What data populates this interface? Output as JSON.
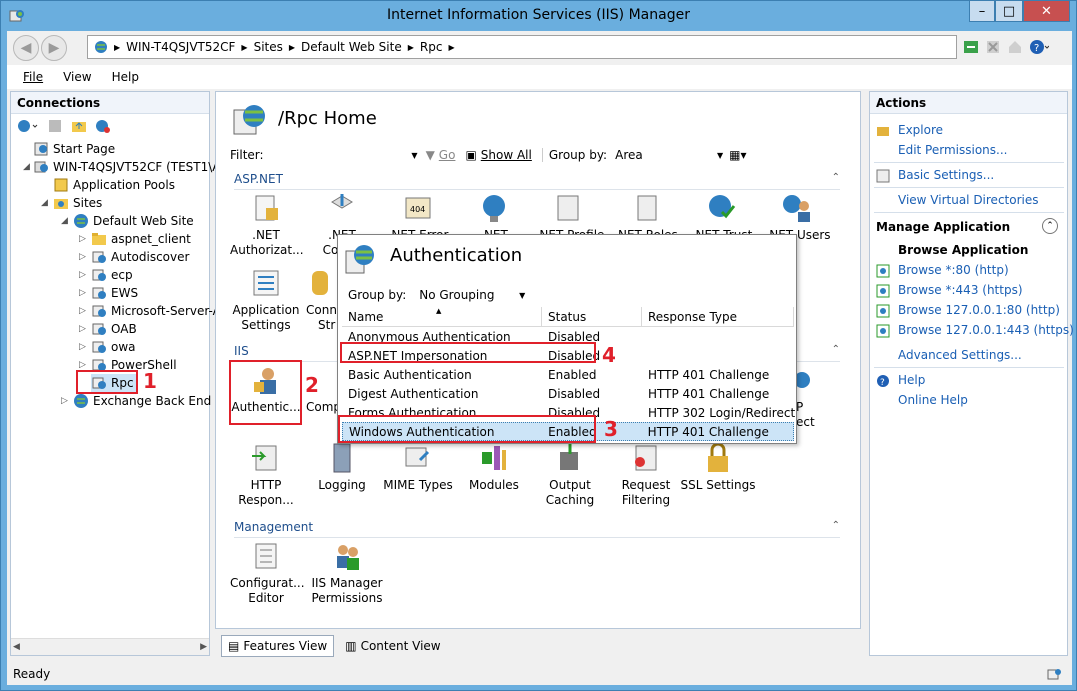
{
  "window": {
    "title": "Internet Information Services (IIS) Manager",
    "minimize": "–",
    "maximize": "□",
    "close": "✕"
  },
  "address": {
    "segments": [
      "WIN-T4QSJVT52CF",
      "Sites",
      "Default Web Site",
      "Rpc"
    ]
  },
  "menu": {
    "file": "File",
    "view": "View",
    "help": "Help"
  },
  "connections": {
    "title": "Connections",
    "tree": [
      {
        "label": "Start Page"
      },
      {
        "label": "WIN-T4QSJVT52CF (TEST1\\Ad"
      },
      {
        "label": "Application Pools"
      },
      {
        "label": "Sites"
      },
      {
        "label": "Default Web Site"
      },
      {
        "label": "aspnet_client"
      },
      {
        "label": "Autodiscover"
      },
      {
        "label": "ecp"
      },
      {
        "label": "EWS"
      },
      {
        "label": "Microsoft-Server-A"
      },
      {
        "label": "OAB"
      },
      {
        "label": "owa"
      },
      {
        "label": "PowerShell"
      },
      {
        "label": "Rpc"
      },
      {
        "label": "Exchange Back End"
      }
    ]
  },
  "center": {
    "title": "/Rpc Home",
    "filter_label": "Filter:",
    "go_label": "Go",
    "show_all_label": "Show All",
    "group_by_label": "Group by:",
    "group_by_value": "Area",
    "groups": {
      "aspnet": "ASP.NET",
      "iis": "IIS",
      "management": "Management"
    },
    "aspnet_features": [
      {
        "l1": ".NET",
        "l2": "Authorizat..."
      },
      {
        "l1": ".NET",
        "l2": "Com..."
      },
      {
        "l1": ".NET Error",
        "l2": ""
      },
      {
        "l1": ".NET",
        "l2": ""
      },
      {
        "l1": ".NET Profile",
        "l2": ""
      },
      {
        "l1": ".NET Roles",
        "l2": ""
      },
      {
        "l1": ".NET Trust",
        "l2": ""
      },
      {
        "l1": ".NET Users",
        "l2": ""
      },
      {
        "l1": "Application",
        "l2": "Settings"
      },
      {
        "l1": "Conn",
        "l2": "Str"
      }
    ],
    "iis_features": [
      {
        "l1": "Authentic...",
        "l2": ""
      },
      {
        "l1": "Comp",
        "l2": ""
      },
      {
        "l1": "HTTP",
        "l2": "Respon..."
      },
      {
        "l1": "Logging",
        "l2": ""
      },
      {
        "l1": "MIME Types",
        "l2": ""
      },
      {
        "l1": "Modules",
        "l2": ""
      },
      {
        "l1": "Output",
        "l2": "Caching"
      },
      {
        "l1": "Request",
        "l2": "Filtering"
      },
      {
        "l1": "SSL Settings",
        "l2": ""
      },
      {
        "l1": "P",
        "l2": "ect"
      }
    ],
    "management_features": [
      {
        "l1": "Configurat...",
        "l2": "Editor"
      },
      {
        "l1": "IIS Manager",
        "l2": "Permissions"
      }
    ],
    "features_view": "Features View",
    "content_view": "Content View"
  },
  "auth_popup": {
    "title": "Authentication",
    "group_by_label": "Group by:",
    "group_by_value": "No Grouping",
    "columns": [
      "Name",
      "Status",
      "Response Type"
    ],
    "rows": [
      {
        "name": "Anonymous Authentication",
        "status": "Disabled",
        "response": ""
      },
      {
        "name": "ASP.NET Impersonation",
        "status": "Disabled",
        "response": ""
      },
      {
        "name": "Basic Authentication",
        "status": "Enabled",
        "response": "HTTP 401 Challenge"
      },
      {
        "name": "Digest Authentication",
        "status": "Disabled",
        "response": "HTTP 401 Challenge"
      },
      {
        "name": "Forms Authentication",
        "status": "Disabled",
        "response": "HTTP 302 Login/Redirect"
      },
      {
        "name": "Windows Authentication",
        "status": "Enabled",
        "response": "HTTP 401 Challenge"
      }
    ]
  },
  "actions": {
    "title": "Actions",
    "explore": "Explore",
    "edit_permissions": "Edit Permissions...",
    "basic_settings": "Basic Settings...",
    "view_virtual_dirs": "View Virtual Directories",
    "manage_app": "Manage Application",
    "browse_app": "Browse Application",
    "browse": [
      "Browse *:80 (http)",
      "Browse *:443 (https)",
      "Browse 127.0.0.1:80 (http)",
      "Browse 127.0.0.1:443 (https)"
    ],
    "advanced_settings": "Advanced Settings...",
    "help": "Help",
    "online_help": "Online Help"
  },
  "annotations": {
    "n1": "1",
    "n2": "2",
    "n3": "3",
    "n4": "4",
    "color": "#e0202a"
  },
  "status": {
    "text": "Ready"
  }
}
